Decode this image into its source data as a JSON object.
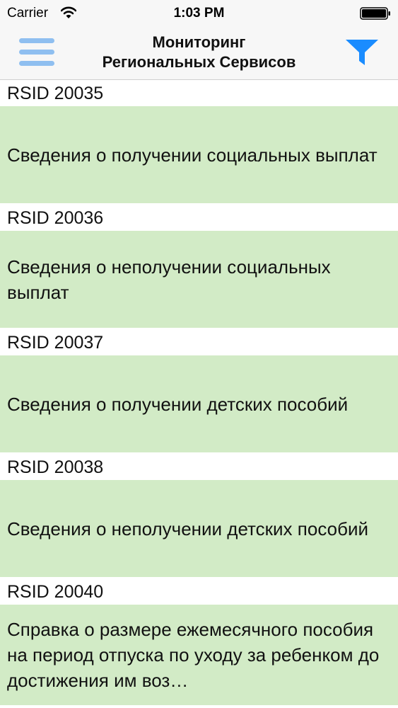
{
  "status_bar": {
    "carrier": "Carrier",
    "time": "1:03 PM",
    "wifi_icon": "wifi-icon",
    "battery_icon": "battery-icon"
  },
  "nav": {
    "title_line1": "Мониторинг",
    "title_line2": "Региональных Сервисов",
    "menu_icon": "hamburger-menu-icon",
    "filter_icon": "filter-funnel-icon",
    "accent_color": "#1a8cff",
    "menu_color": "#8fbff0"
  },
  "list": {
    "row_color": "#d2ebc6",
    "items": [
      {
        "id": "RSID 20035",
        "title": "Сведения о получении социальных выплат"
      },
      {
        "id": "RSID 20036",
        "title": "Сведения о неполучении социальных выплат"
      },
      {
        "id": "RSID 20037",
        "title": "Сведения о получении детских пособий"
      },
      {
        "id": "RSID 20038",
        "title": "Сведения о неполучении детских пособий"
      },
      {
        "id": "RSID 20040",
        "title": "Справка о размере ежемесячного пособия на период отпуска по уходу за ребенком до достижения им воз…"
      }
    ]
  }
}
